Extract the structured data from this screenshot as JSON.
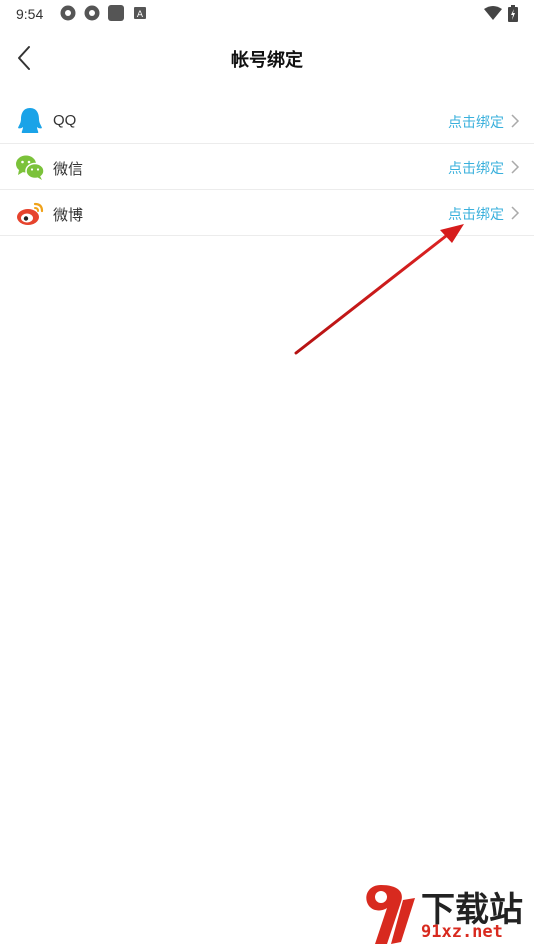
{
  "status_bar": {
    "time": "9:54"
  },
  "header": {
    "title": "帐号绑定"
  },
  "accounts": [
    {
      "name": "QQ",
      "action": "点击绑定",
      "icon": "qq-icon"
    },
    {
      "name": "微信",
      "action": "点击绑定",
      "icon": "wechat-icon"
    },
    {
      "name": "微博",
      "action": "点击绑定",
      "icon": "weibo-icon"
    }
  ],
  "watermark": {
    "title": "下载站",
    "domain": "91xz.net"
  },
  "colors": {
    "action": "#3ab0dc",
    "qq": "#1aa3e8",
    "wechat": "#7bc23a",
    "weibo": "#e6432d",
    "annotation_arrow": "#d61c1c"
  }
}
